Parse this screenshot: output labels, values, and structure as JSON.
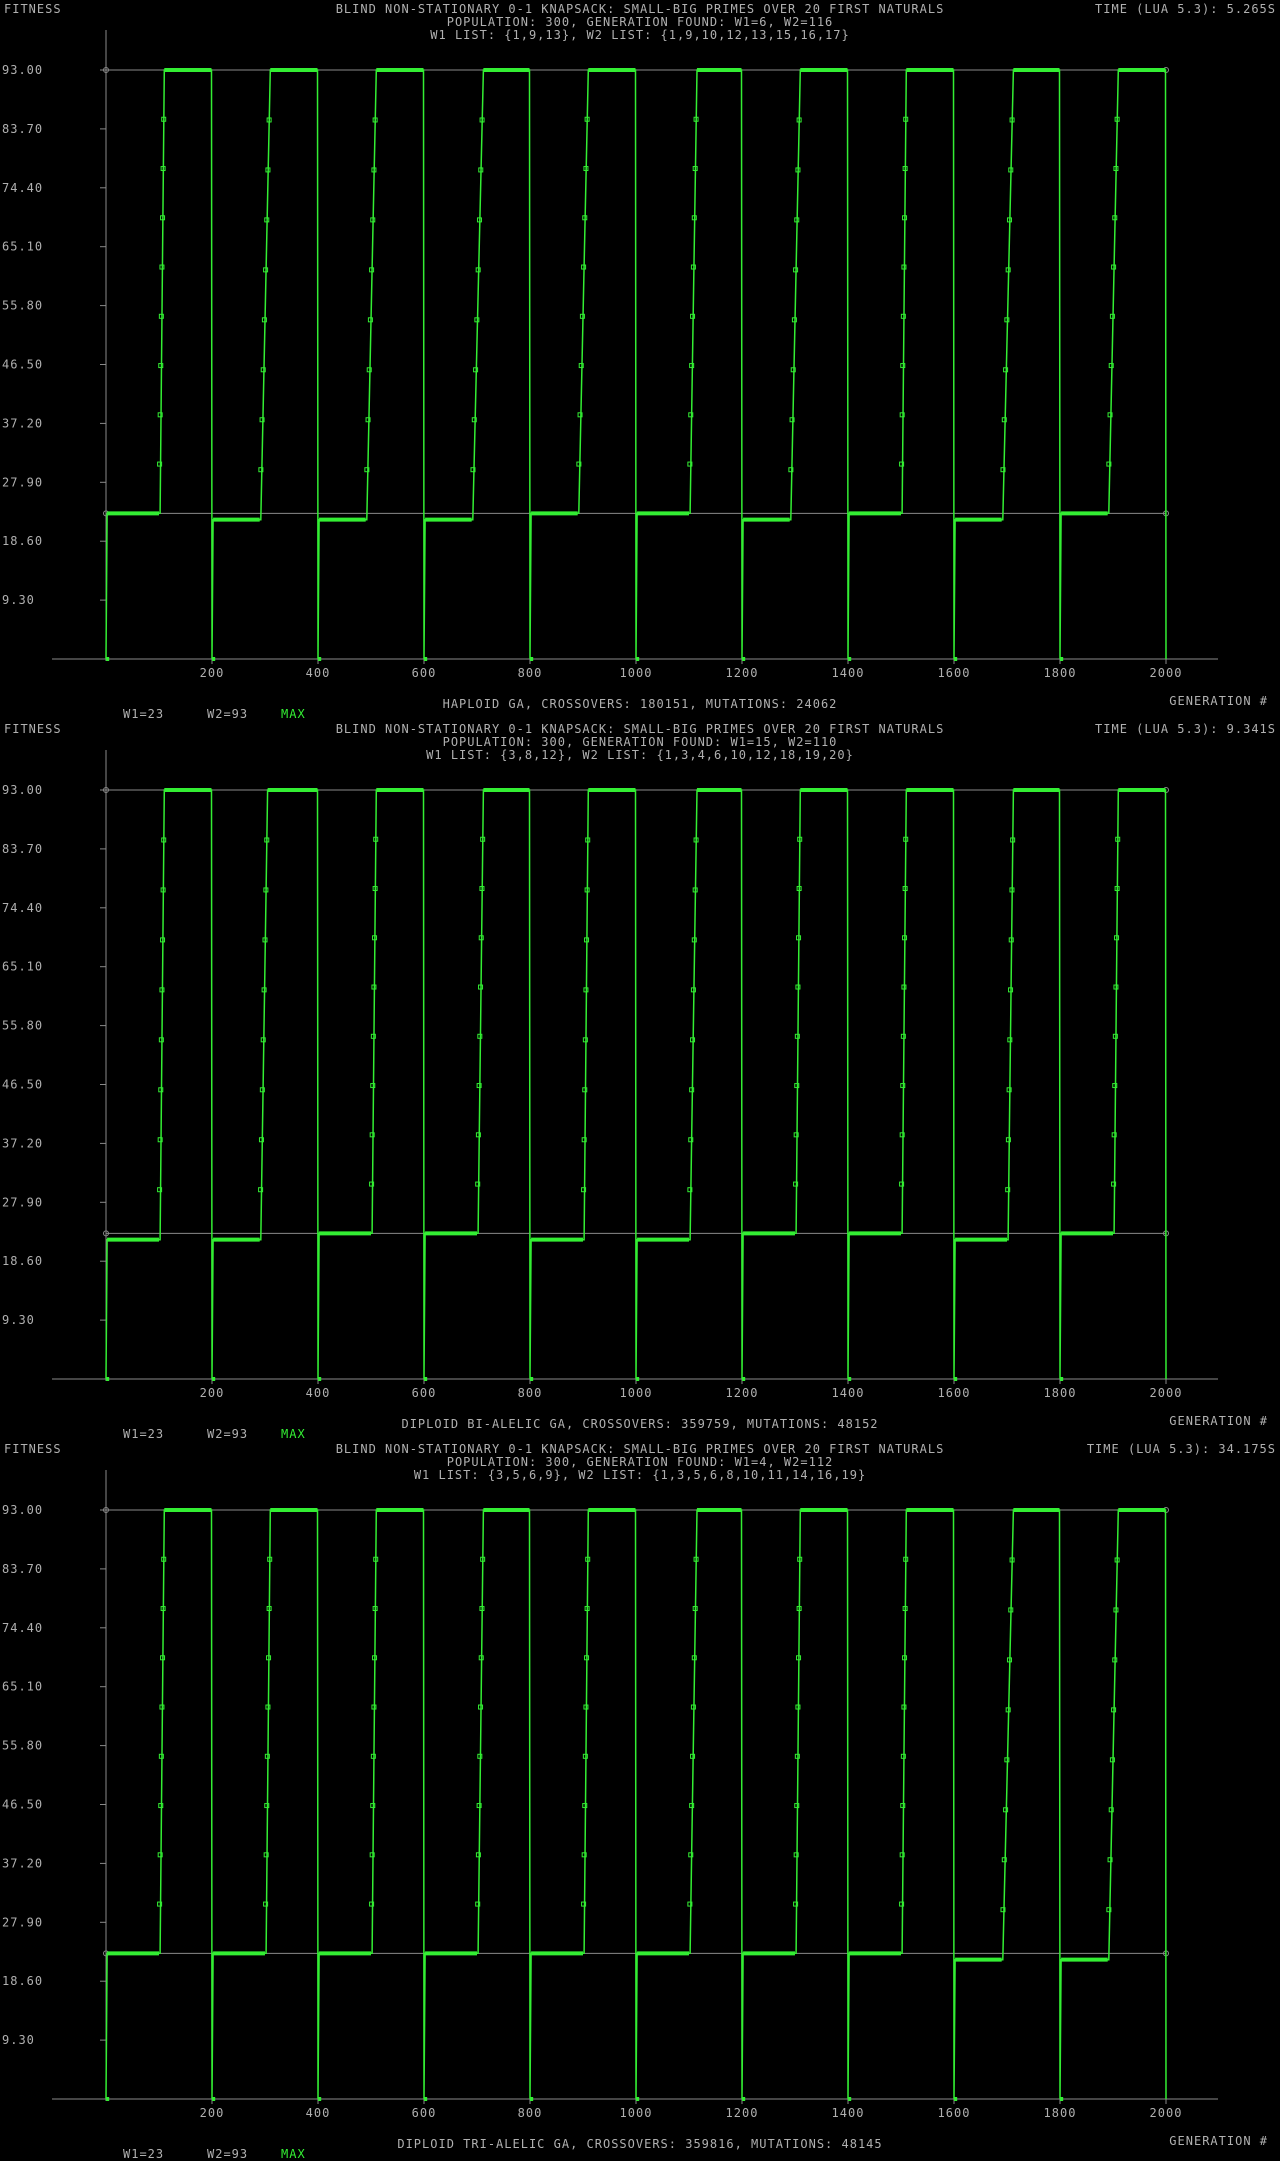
{
  "colors": {
    "background": "#000000",
    "axis": "#8a8a8a",
    "series": "#33ee33",
    "text": "#b0b0b0"
  },
  "charts": [
    {
      "ylabel": "FITNESS",
      "xlabel": "GENERATION #",
      "title": "BLIND NON-STATIONARY 0-1 KNAPSACK: SMALL-BIG PRIMES OVER 20 FIRST NATURALS",
      "line2": "POPULATION: 300, GENERATION FOUND: W1=6, W2=116",
      "line3": "W1 LIST: {1,9,13}, W2 LIST: {1,9,10,12,13,15,16,17}",
      "time": "TIME (LUA 5.3): 5.265S",
      "footer": "HAPLOID GA, CROSSOVERS: 180151, MUTATIONS: 24062",
      "legend_w1": "W1=23",
      "legend_w2": "W2=93",
      "legend_max": "MAX"
    },
    {
      "ylabel": "FITNESS",
      "xlabel": "GENERATION #",
      "title": "BLIND NON-STATIONARY 0-1 KNAPSACK: SMALL-BIG PRIMES OVER 20 FIRST NATURALS",
      "line2": "POPULATION: 300, GENERATION FOUND: W1=15, W2=110",
      "line3": "W1 LIST: {3,8,12}, W2 LIST: {1,3,4,6,10,12,18,19,20}",
      "time": "TIME (LUA 5.3): 9.341S",
      "footer": "DIPLOID BI-ALELIC GA, CROSSOVERS: 359759, MUTATIONS: 48152",
      "legend_w1": "W1=23",
      "legend_w2": "W2=93",
      "legend_max": "MAX"
    },
    {
      "ylabel": "FITNESS",
      "xlabel": "GENERATION #",
      "title": "BLIND NON-STATIONARY 0-1 KNAPSACK: SMALL-BIG PRIMES OVER 20 FIRST NATURALS",
      "line2": "POPULATION: 300, GENERATION FOUND: W1=4, W2=112",
      "line3": "W1 LIST: {3,5,6,9}, W2 LIST: {1,3,5,6,8,10,11,14,16,19}",
      "time": "TIME (LUA 5.3): 34.175S",
      "footer": "DIPLOID TRI-ALELIC GA, CROSSOVERS: 359816, MUTATIONS: 48145",
      "legend_w1": "W1=23",
      "legend_w2": "W2=93",
      "legend_max": "MAX"
    }
  ],
  "chart_data": [
    {
      "type": "line",
      "title": "BLIND NON-STATIONARY 0-1 KNAPSACK: SMALL-BIG PRIMES OVER 20 FIRST NATURALS",
      "xlabel": "GENERATION #",
      "ylabel": "FITNESS",
      "xlim": [
        0,
        2000
      ],
      "ylim": [
        0,
        93
      ],
      "xticks": [
        "200",
        "400",
        "600",
        "800",
        "1000",
        "1200",
        "1400",
        "1600",
        "1800",
        "2000"
      ],
      "yticks": [
        "93.00",
        "83.70",
        "74.40",
        "65.10",
        "55.80",
        "46.50",
        "37.20",
        "27.90",
        "18.60",
        "9.30"
      ],
      "reference_lines": [
        23,
        93
      ],
      "period": 200,
      "series": [
        {
          "name": "MAX"
        }
      ],
      "segments": [
        {
          "start": 0,
          "low": 23,
          "low_end": 100,
          "high": 93,
          "high_start": 110
        },
        {
          "start": 200,
          "low": 22,
          "low_end": 290,
          "high": 93,
          "high_start": 310
        },
        {
          "start": 400,
          "low": 22,
          "low_end": 490,
          "high": 93,
          "high_start": 510
        },
        {
          "start": 600,
          "low": 22,
          "low_end": 690,
          "high": 93,
          "high_start": 712
        },
        {
          "start": 800,
          "low": 23,
          "low_end": 890,
          "high": 93,
          "high_start": 910
        },
        {
          "start": 1000,
          "low": 23,
          "low_end": 1100,
          "high": 93,
          "high_start": 1115
        },
        {
          "start": 1200,
          "low": 22,
          "low_end": 1290,
          "high": 93,
          "high_start": 1310
        },
        {
          "start": 1400,
          "low": 23,
          "low_end": 1500,
          "high": 93,
          "high_start": 1510
        },
        {
          "start": 1600,
          "low": 22,
          "low_end": 1690,
          "high": 93,
          "high_start": 1712
        },
        {
          "start": 1800,
          "low": 23,
          "low_end": 1890,
          "high": 93,
          "high_start": 1910
        }
      ]
    },
    {
      "type": "line",
      "title": "BLIND NON-STATIONARY 0-1 KNAPSACK: SMALL-BIG PRIMES OVER 20 FIRST NATURALS",
      "xlabel": "GENERATION #",
      "ylabel": "FITNESS",
      "xlim": [
        0,
        2000
      ],
      "ylim": [
        0,
        93
      ],
      "xticks": [
        "200",
        "400",
        "600",
        "800",
        "1000",
        "1200",
        "1400",
        "1600",
        "1800",
        "2000"
      ],
      "yticks": [
        "93.00",
        "83.70",
        "74.40",
        "65.10",
        "55.80",
        "46.50",
        "37.20",
        "27.90",
        "18.60",
        "9.30"
      ],
      "reference_lines": [
        23,
        93
      ],
      "period": 200,
      "series": [
        {
          "name": "MAX"
        }
      ],
      "segments": [
        {
          "start": 0,
          "low": 22,
          "low_end": 100,
          "high": 93,
          "high_start": 110
        },
        {
          "start": 200,
          "low": 22,
          "low_end": 290,
          "high": 93,
          "high_start": 305
        },
        {
          "start": 400,
          "low": 23,
          "low_end": 500,
          "high": 93,
          "high_start": 510
        },
        {
          "start": 600,
          "low": 23,
          "low_end": 700,
          "high": 93,
          "high_start": 712
        },
        {
          "start": 800,
          "low": 22,
          "low_end": 900,
          "high": 93,
          "high_start": 910
        },
        {
          "start": 1000,
          "low": 22,
          "low_end": 1100,
          "high": 93,
          "high_start": 1115
        },
        {
          "start": 1200,
          "low": 23,
          "low_end": 1300,
          "high": 93,
          "high_start": 1310
        },
        {
          "start": 1400,
          "low": 23,
          "low_end": 1500,
          "high": 93,
          "high_start": 1510
        },
        {
          "start": 1600,
          "low": 22,
          "low_end": 1700,
          "high": 93,
          "high_start": 1712
        },
        {
          "start": 1800,
          "low": 23,
          "low_end": 1900,
          "high": 93,
          "high_start": 1910
        }
      ]
    },
    {
      "type": "line",
      "title": "BLIND NON-STATIONARY 0-1 KNAPSACK: SMALL-BIG PRIMES OVER 20 FIRST NATURALS",
      "xlabel": "GENERATION #",
      "ylabel": "FITNESS",
      "xlim": [
        0,
        2000
      ],
      "ylim": [
        0,
        93
      ],
      "xticks": [
        "200",
        "400",
        "600",
        "800",
        "1000",
        "1200",
        "1400",
        "1600",
        "1800",
        "2000"
      ],
      "yticks": [
        "93.00",
        "83.70",
        "74.40",
        "65.10",
        "55.80",
        "46.50",
        "37.20",
        "27.90",
        "18.60",
        "9.30"
      ],
      "reference_lines": [
        23,
        93
      ],
      "period": 200,
      "series": [
        {
          "name": "MAX"
        }
      ],
      "segments": [
        {
          "start": 0,
          "low": 23,
          "low_end": 100,
          "high": 93,
          "high_start": 110
        },
        {
          "start": 200,
          "low": 23,
          "low_end": 300,
          "high": 93,
          "high_start": 310
        },
        {
          "start": 400,
          "low": 23,
          "low_end": 500,
          "high": 93,
          "high_start": 510
        },
        {
          "start": 600,
          "low": 23,
          "low_end": 700,
          "high": 93,
          "high_start": 712
        },
        {
          "start": 800,
          "low": 23,
          "low_end": 900,
          "high": 93,
          "high_start": 910
        },
        {
          "start": 1000,
          "low": 23,
          "low_end": 1100,
          "high": 93,
          "high_start": 1115
        },
        {
          "start": 1200,
          "low": 23,
          "low_end": 1300,
          "high": 93,
          "high_start": 1310
        },
        {
          "start": 1400,
          "low": 23,
          "low_end": 1500,
          "high": 93,
          "high_start": 1510
        },
        {
          "start": 1600,
          "low": 22,
          "low_end": 1690,
          "high": 93,
          "high_start": 1712
        },
        {
          "start": 1800,
          "low": 22,
          "low_end": 1890,
          "high": 93,
          "high_start": 1910
        }
      ]
    }
  ]
}
